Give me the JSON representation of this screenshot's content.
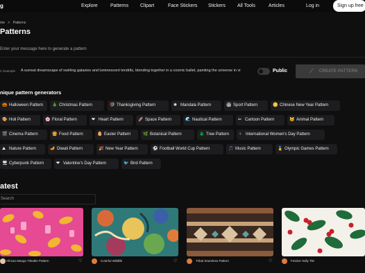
{
  "nav": {
    "logo_fragment": "g",
    "links": [
      "Explore",
      "Patterns",
      "Clipart",
      "Face Stickers",
      "Stickers",
      "All Tools",
      "Articles"
    ],
    "login": "Log in",
    "signup": "Sign up free"
  },
  "breadcrumb": {
    "home": "me",
    "separator": ">",
    "current": "Patterns"
  },
  "page_title": "Patterns",
  "prompt": {
    "placeholder": "Enter your message here to generate a pattern"
  },
  "example": {
    "label": "C  Example",
    "text": "A surreal dreamscape of swirling galaxies and luminescent tendrils, blending together in a cosmic ballet, painting the universe in vi"
  },
  "visibility": {
    "label": "Public",
    "on": false
  },
  "create_button": "CREATE PATTERN",
  "generators": {
    "heading": "nique pattern generators",
    "rows": [
      [
        {
          "label": "Halloween Pattern",
          "icon": "pumpkin-icon",
          "glyph": "🎃"
        },
        {
          "label": "Christmas Pattern",
          "icon": "tree-icon",
          "glyph": "🎄"
        },
        {
          "label": "Thanksgiving Pattern",
          "icon": "turkey-icon",
          "glyph": "🦃"
        },
        {
          "label": "Mandala Pattern",
          "icon": "mandala-icon",
          "glyph": "✺"
        },
        {
          "label": "Sport Pattern",
          "icon": "stadium-icon",
          "glyph": "🏟"
        },
        {
          "label": "Chinese New Year Pattern",
          "icon": "coins-icon",
          "glyph": "🪙"
        }
      ],
      [
        {
          "label": "Holi Pattern",
          "icon": "palette-icon",
          "glyph": "🎨"
        },
        {
          "label": "Floral Pattern",
          "icon": "flower-icon",
          "glyph": "🌸"
        },
        {
          "label": "Heart Pattern",
          "icon": "heart-icon",
          "glyph": "❤"
        },
        {
          "label": "Space Pattern",
          "icon": "rocket-icon",
          "glyph": "🚀"
        },
        {
          "label": "Nautical Pattern",
          "icon": "wave-icon",
          "glyph": "🌊"
        },
        {
          "label": "Cartoon Pattern",
          "icon": "pencil-icon",
          "glyph": "✏"
        },
        {
          "label": "Animal Pattern",
          "icon": "cat-icon",
          "glyph": "🐱"
        }
      ],
      [
        {
          "label": "Cinema Pattern",
          "icon": "clapper-icon",
          "glyph": "🎬"
        },
        {
          "label": "Food Pattern",
          "icon": "burger-icon",
          "glyph": "🍔"
        },
        {
          "label": "Easter Pattern",
          "icon": "egg-icon",
          "glyph": "🥚"
        },
        {
          "label": "Botanical Pattern",
          "icon": "leaf-icon",
          "glyph": "🌿"
        },
        {
          "label": "Tree Pattern",
          "icon": "pine-icon",
          "glyph": "🌲"
        },
        {
          "label": "International Women's Day Pattern",
          "icon": "women-icon",
          "glyph": "♀"
        }
      ],
      [
        {
          "label": "Nature Pattern",
          "icon": "mountain-icon",
          "glyph": "⛰"
        },
        {
          "label": "Diwali Pattern",
          "icon": "lamp-icon",
          "glyph": "🪔"
        },
        {
          "label": "New Year Pattern",
          "icon": "party-icon",
          "glyph": "🎉"
        },
        {
          "label": "Football World Cup Pattern",
          "icon": "ball-icon",
          "glyph": "⚽"
        },
        {
          "label": "Music Pattern",
          "icon": "music-icon",
          "glyph": "🎵"
        },
        {
          "label": "Olympic Games Pattern",
          "icon": "medal-icon",
          "glyph": "🏅"
        }
      ],
      [
        {
          "label": "Cyberpunk Pattern",
          "icon": "circuit-icon",
          "glyph": "🖥"
        },
        {
          "label": "Valentine's Day Pattern",
          "icon": "heart-icon",
          "glyph": "❤"
        },
        {
          "label": "Bird Pattern",
          "icon": "bird-icon",
          "glyph": "🐦"
        }
      ]
    ]
  },
  "latest": {
    "heading": "atest",
    "search_placeholder": "Search",
    "cards": [
      {
        "caption": "African Mango Tileable Pattern",
        "avatar_color": "#e3c7a8"
      },
      {
        "caption": "Colorful Wildlife",
        "avatar_color": "#e07b3a"
      },
      {
        "caption": "Tribal Seamless Pattern",
        "avatar_color": "#e07b3a"
      },
      {
        "caption": "Festive Holly Tile",
        "avatar_color": "#e07b3a"
      }
    ]
  }
}
